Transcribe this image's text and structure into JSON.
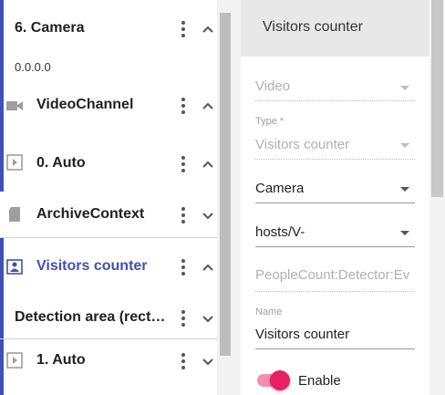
{
  "tree": {
    "items": [
      {
        "label": "6. Camera",
        "sub": "0.0.0.0",
        "icon": "none",
        "expanded": true
      },
      {
        "label": "VideoChannel",
        "icon": "videocam-icon",
        "expanded": true
      },
      {
        "label": "0. Auto",
        "icon": "play-box-icon",
        "expanded": true
      },
      {
        "label": "ArchiveContext",
        "icon": "sd-card-icon",
        "expanded": false
      },
      {
        "label": "Visitors counter",
        "icon": "person-in-area-icon",
        "expanded": true,
        "selected": true
      },
      {
        "label": "Detection area (rect…",
        "icon": "none",
        "expanded": false
      },
      {
        "label": "1. Auto",
        "icon": "play-box-icon",
        "expanded": false
      }
    ]
  },
  "panel": {
    "title": "Visitors counter",
    "fields": {
      "video_value": "Video",
      "type_label": "Type *",
      "type_value": "Visitors counter",
      "camera_value": "Camera",
      "host_value": "hosts/V-",
      "event_value": "PeopleCount:Detector:Ev",
      "name_label": "Name",
      "name_value": "Visitors counter"
    },
    "enable": {
      "label": "Enable",
      "on": true
    }
  },
  "colors": {
    "accent": "#3f51b5",
    "toggle_on": "#e91e63",
    "toggle_track": "#f48fb1"
  }
}
